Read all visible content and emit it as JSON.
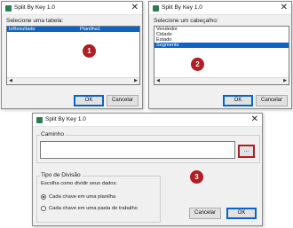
{
  "dialogs": [
    {
      "title": "Split By Key 1.0",
      "close": "✕",
      "prompt": "Selecione uma tabela:",
      "list": [
        {
          "name": "loResultado",
          "sheet": "Planilha1",
          "selected": true
        }
      ],
      "ok": "OK",
      "cancel": "Cancelar",
      "badge": "1"
    },
    {
      "title": "Split By Key 1.0",
      "close": "✕",
      "prompt": "Selecione um cabeçalho:",
      "list": [
        {
          "name": "Vendedor",
          "selected": false
        },
        {
          "name": "Cidade",
          "selected": false
        },
        {
          "name": "Estado",
          "selected": false
        },
        {
          "name": "Segmento",
          "selected": true
        }
      ],
      "ok": "OK",
      "cancel": "Cancelar",
      "badge": "2"
    },
    {
      "title": "Split By Key 1.0",
      "close": "✕",
      "path_group": "Caminho",
      "path_value": "",
      "browse": "...",
      "mode_group": "Tipo de Divisão",
      "mode_prompt": "Escolha como dividir seus dados:",
      "options": [
        {
          "label": "Cada chave em uma planilha",
          "checked": true
        },
        {
          "label": "Cada chave em uma pasta de trabalho",
          "checked": false
        }
      ],
      "cancel": "Cancelar",
      "ok": "OK",
      "badge": "3"
    }
  ],
  "colors": {
    "selection": "#0a64c8",
    "badge": "#b01d24",
    "dialog_bg": "#f0f0f0"
  },
  "icons": {
    "title": "excel-app-icon",
    "close": "close-icon",
    "scroll_left": "chevron-left-icon",
    "scroll_right": "chevron-right-icon"
  }
}
